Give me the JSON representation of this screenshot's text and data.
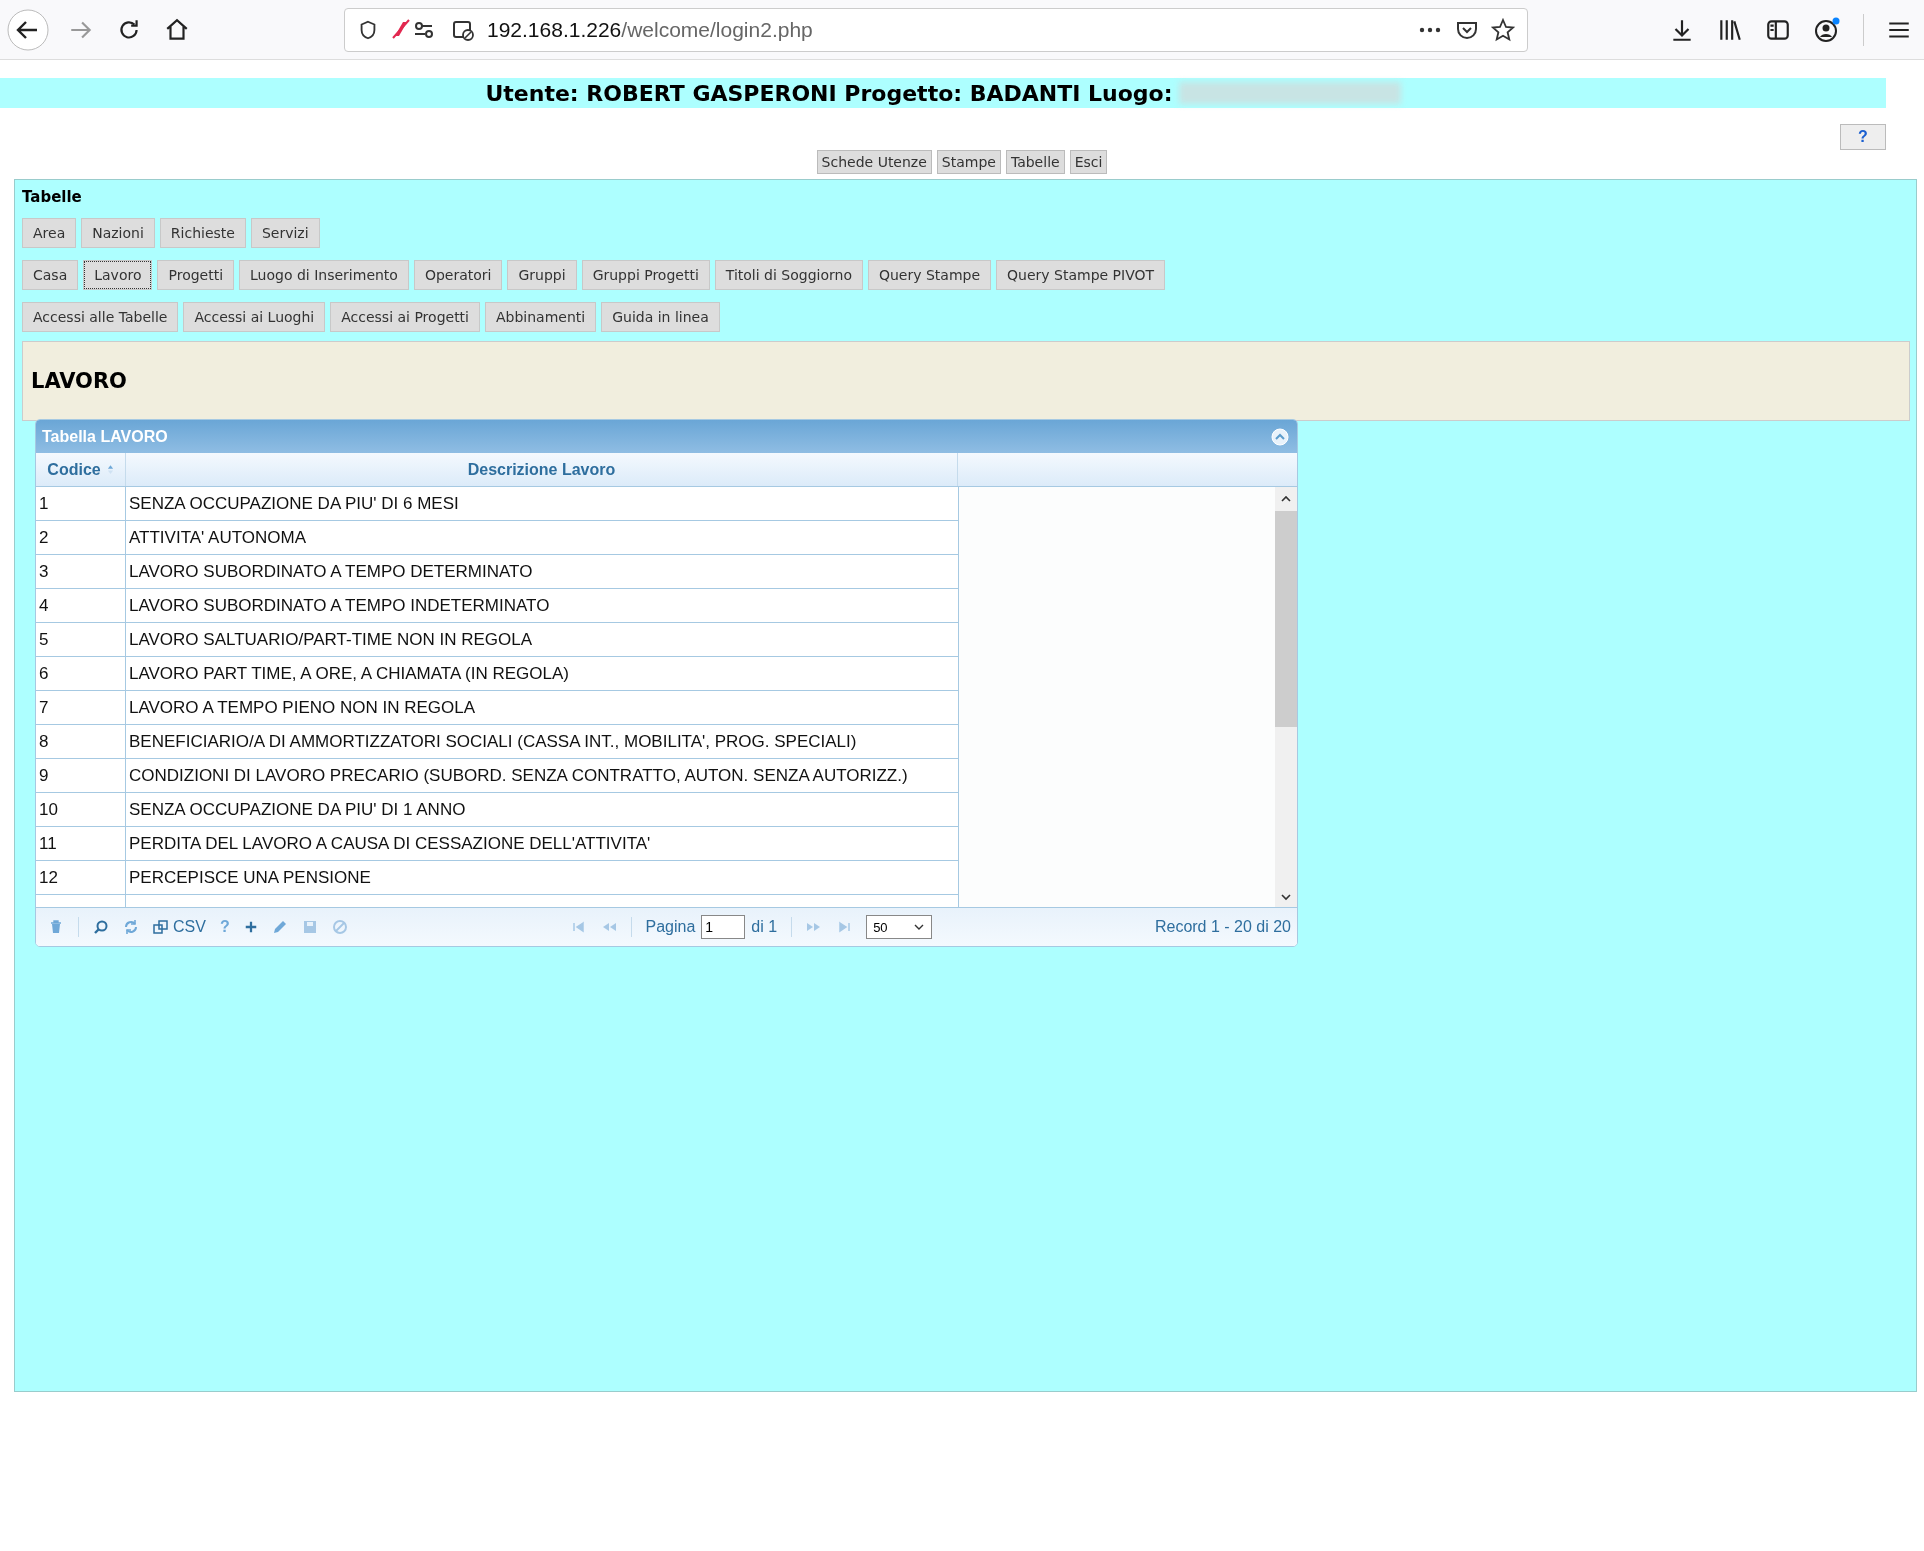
{
  "browser": {
    "url_host": "192.168.1.226",
    "url_path": "/welcome/login2.php"
  },
  "header": {
    "text": "Utente: ROBERT GASPERONI Progetto: BADANTI Luogo:"
  },
  "help_button": "?",
  "nav_buttons": [
    "Schede Utenze",
    "Stampe",
    "Tabelle",
    "Esci"
  ],
  "panel": {
    "title": "Tabelle"
  },
  "tab_rows": [
    [
      {
        "label": "Area",
        "selected": false
      },
      {
        "label": "Nazioni",
        "selected": false
      },
      {
        "label": "Richieste",
        "selected": false
      },
      {
        "label": "Servizi",
        "selected": false
      }
    ],
    [
      {
        "label": "Casa",
        "selected": false
      },
      {
        "label": "Lavoro",
        "selected": true
      },
      {
        "label": "Progetti",
        "selected": false
      },
      {
        "label": "Luogo di Inserimento",
        "selected": false
      },
      {
        "label": "Operatori",
        "selected": false
      },
      {
        "label": "Gruppi",
        "selected": false
      },
      {
        "label": "Gruppi Progetti",
        "selected": false
      },
      {
        "label": "Titoli di Soggiorno",
        "selected": false
      },
      {
        "label": "Query Stampe",
        "selected": false
      },
      {
        "label": "Query Stampe PIVOT",
        "selected": false
      }
    ],
    [
      {
        "label": "Accessi alle Tabelle",
        "selected": false
      },
      {
        "label": "Accessi ai Luoghi",
        "selected": false
      },
      {
        "label": "Accessi ai Progetti",
        "selected": false
      },
      {
        "label": "Abbinamenti",
        "selected": false
      },
      {
        "label": "Guida in linea",
        "selected": false
      }
    ]
  ],
  "section_title": "LAVORO",
  "grid": {
    "title": "Tabella LAVORO",
    "columns": [
      "Codice",
      "Descrizione Lavoro"
    ],
    "rows": [
      [
        "1",
        "SENZA OCCUPAZIONE DA PIU' DI 6 MESI"
      ],
      [
        "2",
        "ATTIVITA' AUTONOMA"
      ],
      [
        "3",
        "LAVORO SUBORDINATO A TEMPO DETERMINATO"
      ],
      [
        "4",
        "LAVORO SUBORDINATO A TEMPO INDETERMINATO"
      ],
      [
        "5",
        "LAVORO SALTUARIO/PART-TIME NON IN REGOLA"
      ],
      [
        "6",
        "LAVORO PART TIME, A ORE, A CHIAMATA (IN REGOLA)"
      ],
      [
        "7",
        "LAVORO A TEMPO PIENO NON IN REGOLA"
      ],
      [
        "8",
        "BENEFICIARIO/A DI AMMORTIZZATORI SOCIALI (CASSA INT., MOBILITA', PROG. SPECIALI)"
      ],
      [
        "9",
        "CONDIZIONI DI LAVORO PRECARIO (SUBORD. SENZA CONTRATTO,  AUTON. SENZA AUTORIZZ.)"
      ],
      [
        "10",
        "SENZA OCCUPAZIONE DA PIU' DI 1 ANNO"
      ],
      [
        "11",
        "PERDITA DEL LAVORO A CAUSA DI CESSAZIONE DELL'ATTIVITA'"
      ],
      [
        "12",
        "PERCEPISCE UNA PENSIONE"
      ]
    ],
    "pager": {
      "csv": "CSV",
      "help": "?",
      "page_label": "Pagina",
      "page_value": "1",
      "page_of": "di 1",
      "page_size": "50",
      "records": "Record 1 - 20 di 20"
    }
  }
}
